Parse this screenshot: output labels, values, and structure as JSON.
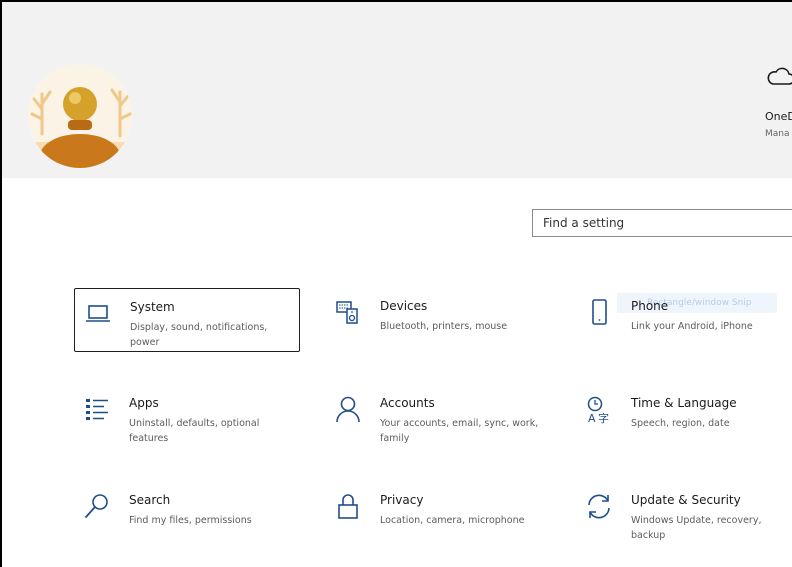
{
  "header": {
    "onedrive": {
      "title": "OneD",
      "subtitle": "Mana",
      "icon": "cloud-icon"
    }
  },
  "search": {
    "placeholder": "Find a setting"
  },
  "ghost_text": "Rectangle/window Snip",
  "tiles": [
    {
      "title": "System",
      "desc": "Display, sound, notifications, power",
      "icon": "laptop-icon"
    },
    {
      "title": "Devices",
      "desc": "Bluetooth, printers, mouse",
      "icon": "keyboard-speaker-icon"
    },
    {
      "title": "Phone",
      "desc": "Link your Android, iPhone",
      "icon": "phone-icon"
    },
    {
      "title": "Apps",
      "desc": "Uninstall, defaults, optional features",
      "icon": "apps-list-icon"
    },
    {
      "title": "Accounts",
      "desc": "Your accounts, email, sync, work, family",
      "icon": "person-icon"
    },
    {
      "title": "Time & Language",
      "desc": "Speech, region, date",
      "icon": "time-language-icon"
    },
    {
      "title": "Search",
      "desc": "Find my files, permissions",
      "icon": "search-icon"
    },
    {
      "title": "Privacy",
      "desc": "Location, camera, microphone",
      "icon": "lock-icon"
    },
    {
      "title": "Update & Security",
      "desc": "Windows Update, recovery, backup",
      "icon": "sync-icon"
    }
  ],
  "colors": {
    "accent": "#0067c0",
    "header_bg": "#f2f2f2"
  }
}
